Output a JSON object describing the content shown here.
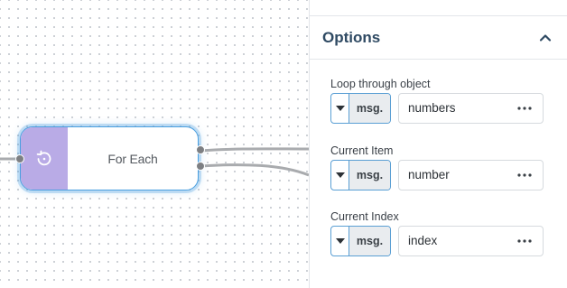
{
  "node": {
    "label": "For Each",
    "icon": "loop-icon",
    "color": "#b9abe6",
    "selected": true
  },
  "panel": {
    "section_title": "Options",
    "collapse_icon": "chevron-up-icon",
    "fields": [
      {
        "label": "Loop through object",
        "type": "msg.",
        "value": "numbers"
      },
      {
        "label": "Current Item",
        "type": "msg.",
        "value": "number"
      },
      {
        "label": "Current Index",
        "type": "msg.",
        "value": "index"
      }
    ]
  }
}
